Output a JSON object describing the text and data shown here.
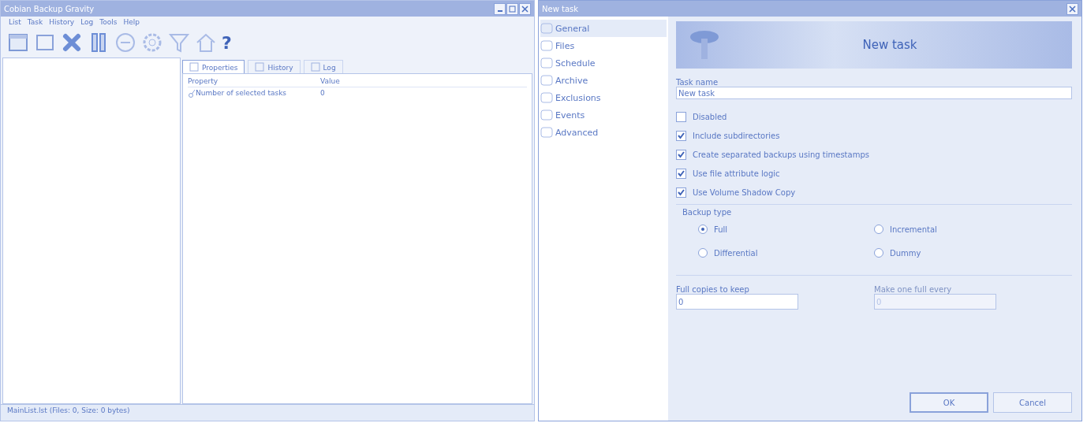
{
  "main_window": {
    "title": "Cobian Backup Gravity",
    "menu": [
      "List",
      "Task",
      "History",
      "Log",
      "Tools",
      "Help"
    ],
    "toolbar": [
      {
        "kind": "new"
      },
      {
        "kind": "edit"
      },
      {
        "kind": "delete"
      },
      {
        "kind": "pause"
      },
      {
        "kind": "stop"
      },
      {
        "kind": "gear"
      },
      {
        "kind": "filter"
      },
      {
        "kind": "home"
      },
      {
        "kind": "help",
        "label": "?"
      }
    ],
    "tabs": [
      {
        "label": "Properties",
        "selected": true
      },
      {
        "label": "History",
        "selected": false
      },
      {
        "label": "Log",
        "selected": false
      }
    ],
    "table": {
      "columns": [
        "Property",
        "Value"
      ],
      "rows": [
        [
          "Number of selected tasks",
          "0"
        ]
      ]
    },
    "status_bar": "MainList.lst (Files: 0, Size: 0 bytes)"
  },
  "dialog": {
    "title": "New task",
    "sidebar": [
      {
        "label": "General",
        "selected": true
      },
      {
        "label": "Files",
        "selected": false
      },
      {
        "label": "Schedule",
        "selected": false
      },
      {
        "label": "Archive",
        "selected": false
      },
      {
        "label": "Exclusions",
        "selected": false
      },
      {
        "label": "Events",
        "selected": false
      },
      {
        "label": "Advanced",
        "selected": false
      }
    ],
    "header": "New task",
    "task_name": {
      "label": "Task name",
      "value": "New task"
    },
    "checkboxes": [
      {
        "label": "Disabled",
        "checked": false
      },
      {
        "label": "Include subdirectories",
        "checked": true
      },
      {
        "label": "Create separated backups using timestamps",
        "checked": true
      },
      {
        "label": "Use file attribute logic",
        "checked": true
      },
      {
        "label": "Use Volume Shadow Copy",
        "checked": true
      }
    ],
    "backup_type": {
      "label": "Backup type",
      "options": [
        {
          "label": "Full",
          "selected": true
        },
        {
          "label": "Incremental",
          "selected": false
        },
        {
          "label": "Differential",
          "selected": false
        },
        {
          "label": "Dummy",
          "selected": false
        }
      ]
    },
    "fields": [
      {
        "label": "Full copies to keep",
        "value": "0",
        "disabled": false
      },
      {
        "label": "Make one full every",
        "value": "0",
        "disabled": true
      }
    ],
    "buttons": [
      "OK",
      "Cancel"
    ]
  }
}
